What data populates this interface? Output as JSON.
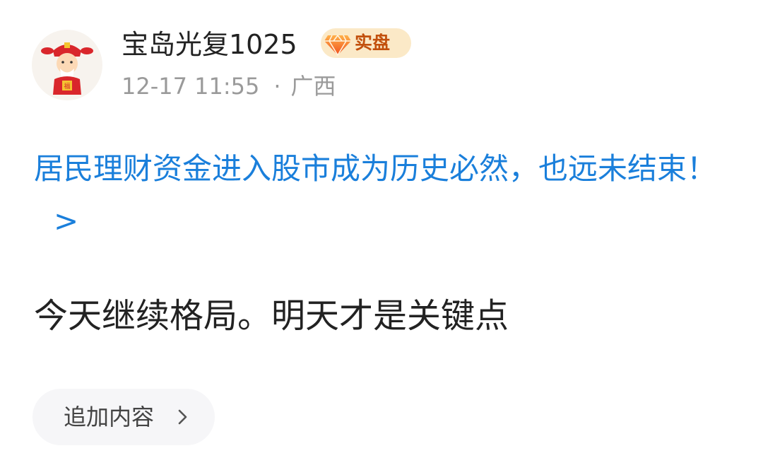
{
  "post": {
    "username": "宝岛光复1025",
    "badge": "实盘",
    "timestamp": "12-17 11:55",
    "separator": "·",
    "location": "广西",
    "headline": "居民理财资金进入股市成为历史必然，也远未结束！",
    "headline_arrow": ">",
    "body": "今天继续格局。明天才是关键点",
    "append_button": "追加内容"
  },
  "colors": {
    "link": "#1a7fdb",
    "badge_bg": "#fbe9c7",
    "badge_text": "#c2500d",
    "meta": "#9a9a9a"
  },
  "icons": {
    "avatar": "god-of-wealth-avatar",
    "badge": "diamond-icon",
    "button": "chevron-right-icon"
  }
}
